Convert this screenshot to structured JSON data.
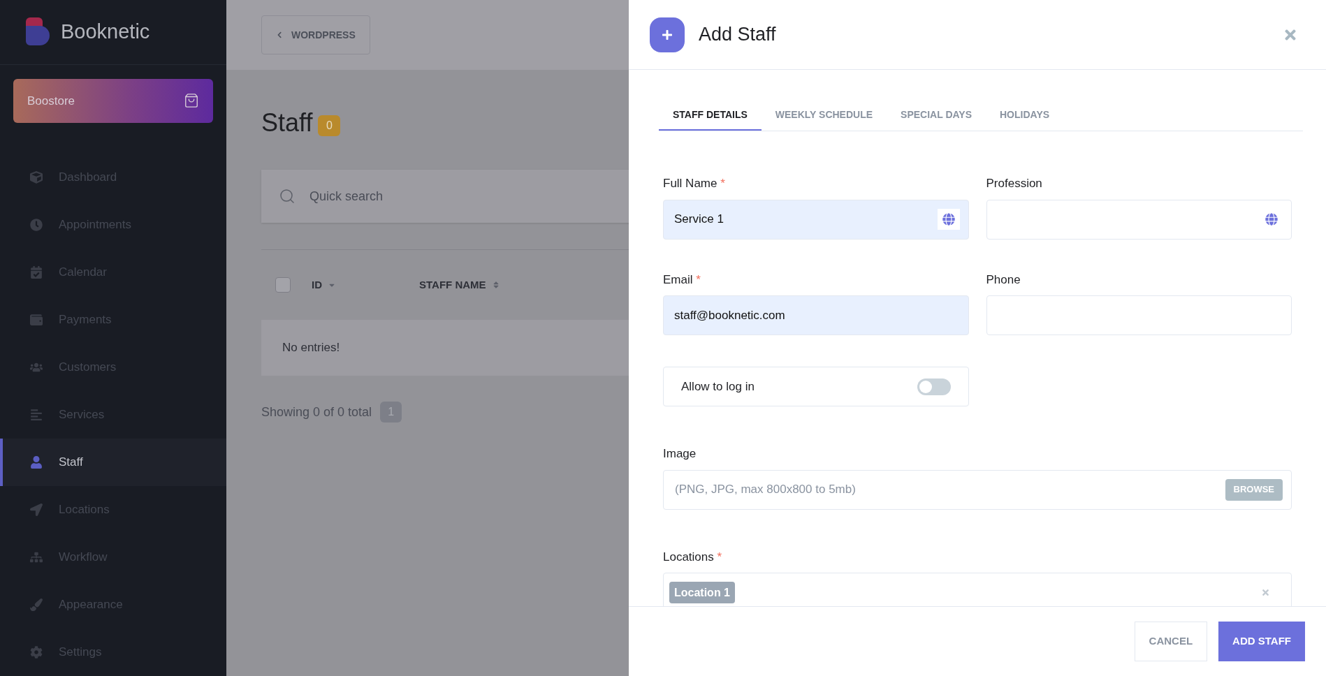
{
  "sidebar": {
    "brand": "Booknetic",
    "boostore": "Boostore",
    "items": [
      {
        "label": "Dashboard",
        "selected": false
      },
      {
        "label": "Appointments",
        "selected": false
      },
      {
        "label": "Calendar",
        "selected": false
      },
      {
        "label": "Payments",
        "selected": false
      },
      {
        "label": "Customers",
        "selected": false
      },
      {
        "label": "Services",
        "selected": false
      },
      {
        "label": "Staff",
        "selected": true
      },
      {
        "label": "Locations",
        "selected": false
      },
      {
        "label": "Workflow",
        "selected": false
      },
      {
        "label": "Appearance",
        "selected": false
      },
      {
        "label": "Settings",
        "selected": false
      }
    ]
  },
  "page": {
    "back_button": "WORDPRESS",
    "title": "Staff",
    "count": "0",
    "search": {
      "placeholder": "Quick search"
    },
    "table": {
      "select_all": {
        "checked": false
      },
      "columns": [
        {
          "label": "ID",
          "kind": "sorted"
        },
        {
          "label": "STAFF NAME",
          "kind": "sortable"
        }
      ],
      "empty": "No entries!"
    },
    "footer": "Showing 0 of 0 total",
    "pages": [
      {
        "label": "1",
        "selected": true
      }
    ]
  },
  "panel": {
    "title": "Add Staff",
    "tabs": [
      {
        "label": "STAFF DETAILS",
        "selected": true
      },
      {
        "label": "WEEKLY SCHEDULE",
        "selected": false
      },
      {
        "label": "SPECIAL DAYS",
        "selected": false
      },
      {
        "label": "HOLIDAYS",
        "selected": false
      }
    ],
    "fields": [
      {
        "kind": "text",
        "label": "Full Name",
        "required_mark": "*",
        "value": "Service 1",
        "autofilled": true,
        "translatable": true
      },
      {
        "kind": "text",
        "label": "Profession",
        "autofilled": false,
        "translatable": true
      },
      {
        "kind": "text",
        "label": "Email",
        "required_mark": "*",
        "value": "staff@booknetic.com",
        "autofilled": true,
        "translatable": false
      },
      {
        "kind": "text",
        "label": "Phone",
        "autofilled": false,
        "translatable": false
      },
      {
        "kind": "toggle",
        "label": "Allow to log in",
        "on": false
      },
      {
        "kind": "file",
        "label": "Image",
        "placeholder": "(PNG, JPG, max 800x800 to 5mb)",
        "button": "BROWSE"
      },
      {
        "kind": "tags",
        "label": "Locations",
        "required_mark": "*",
        "tags": [
          "Location 1"
        ]
      }
    ],
    "buttons": [
      {
        "label": "CANCEL",
        "kind": "secondary"
      },
      {
        "label": "ADD STAFF",
        "kind": "primary"
      }
    ]
  }
}
